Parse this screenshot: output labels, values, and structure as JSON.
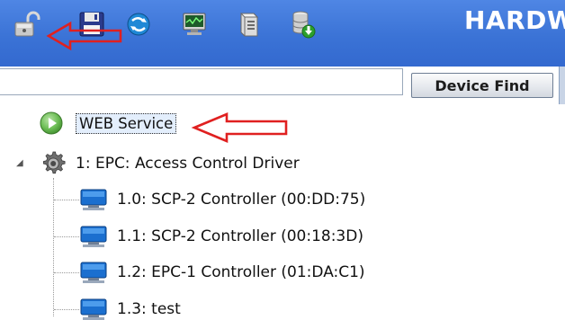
{
  "toolbar": {
    "brand": "HARDW",
    "buttons": [
      {
        "name": "unlock-icon"
      },
      {
        "name": "floppy-save-icon"
      },
      {
        "name": "refresh-globe-icon"
      },
      {
        "name": "monitor-icon"
      },
      {
        "name": "server-icon"
      },
      {
        "name": "database-download-icon"
      }
    ]
  },
  "subbar": {
    "device_find_label": "Device Find"
  },
  "tree": {
    "web_service": {
      "label": "WEB Service",
      "icon": "play-circle-icon"
    },
    "driver": {
      "label": "1:  EPC: Access Control Driver",
      "icon": "gear-icon",
      "expanded": true
    },
    "children": [
      {
        "label": "1.0:  SCP-2 Controller (00:DD:75)",
        "icon": "monitor-icon"
      },
      {
        "label": "1.1:  SCP-2 Controller (00:18:3D)",
        "icon": "monitor-icon"
      },
      {
        "label": "1.2:  EPC-1 Controller (01:DA:C1)",
        "icon": "monitor-icon"
      },
      {
        "label": "1.3:  test",
        "icon": "monitor-icon"
      }
    ]
  },
  "colors": {
    "toolbar_bg": "#3b73d6",
    "annotation_arrow": "#e02020",
    "selection_bg": "#e3eefc"
  }
}
